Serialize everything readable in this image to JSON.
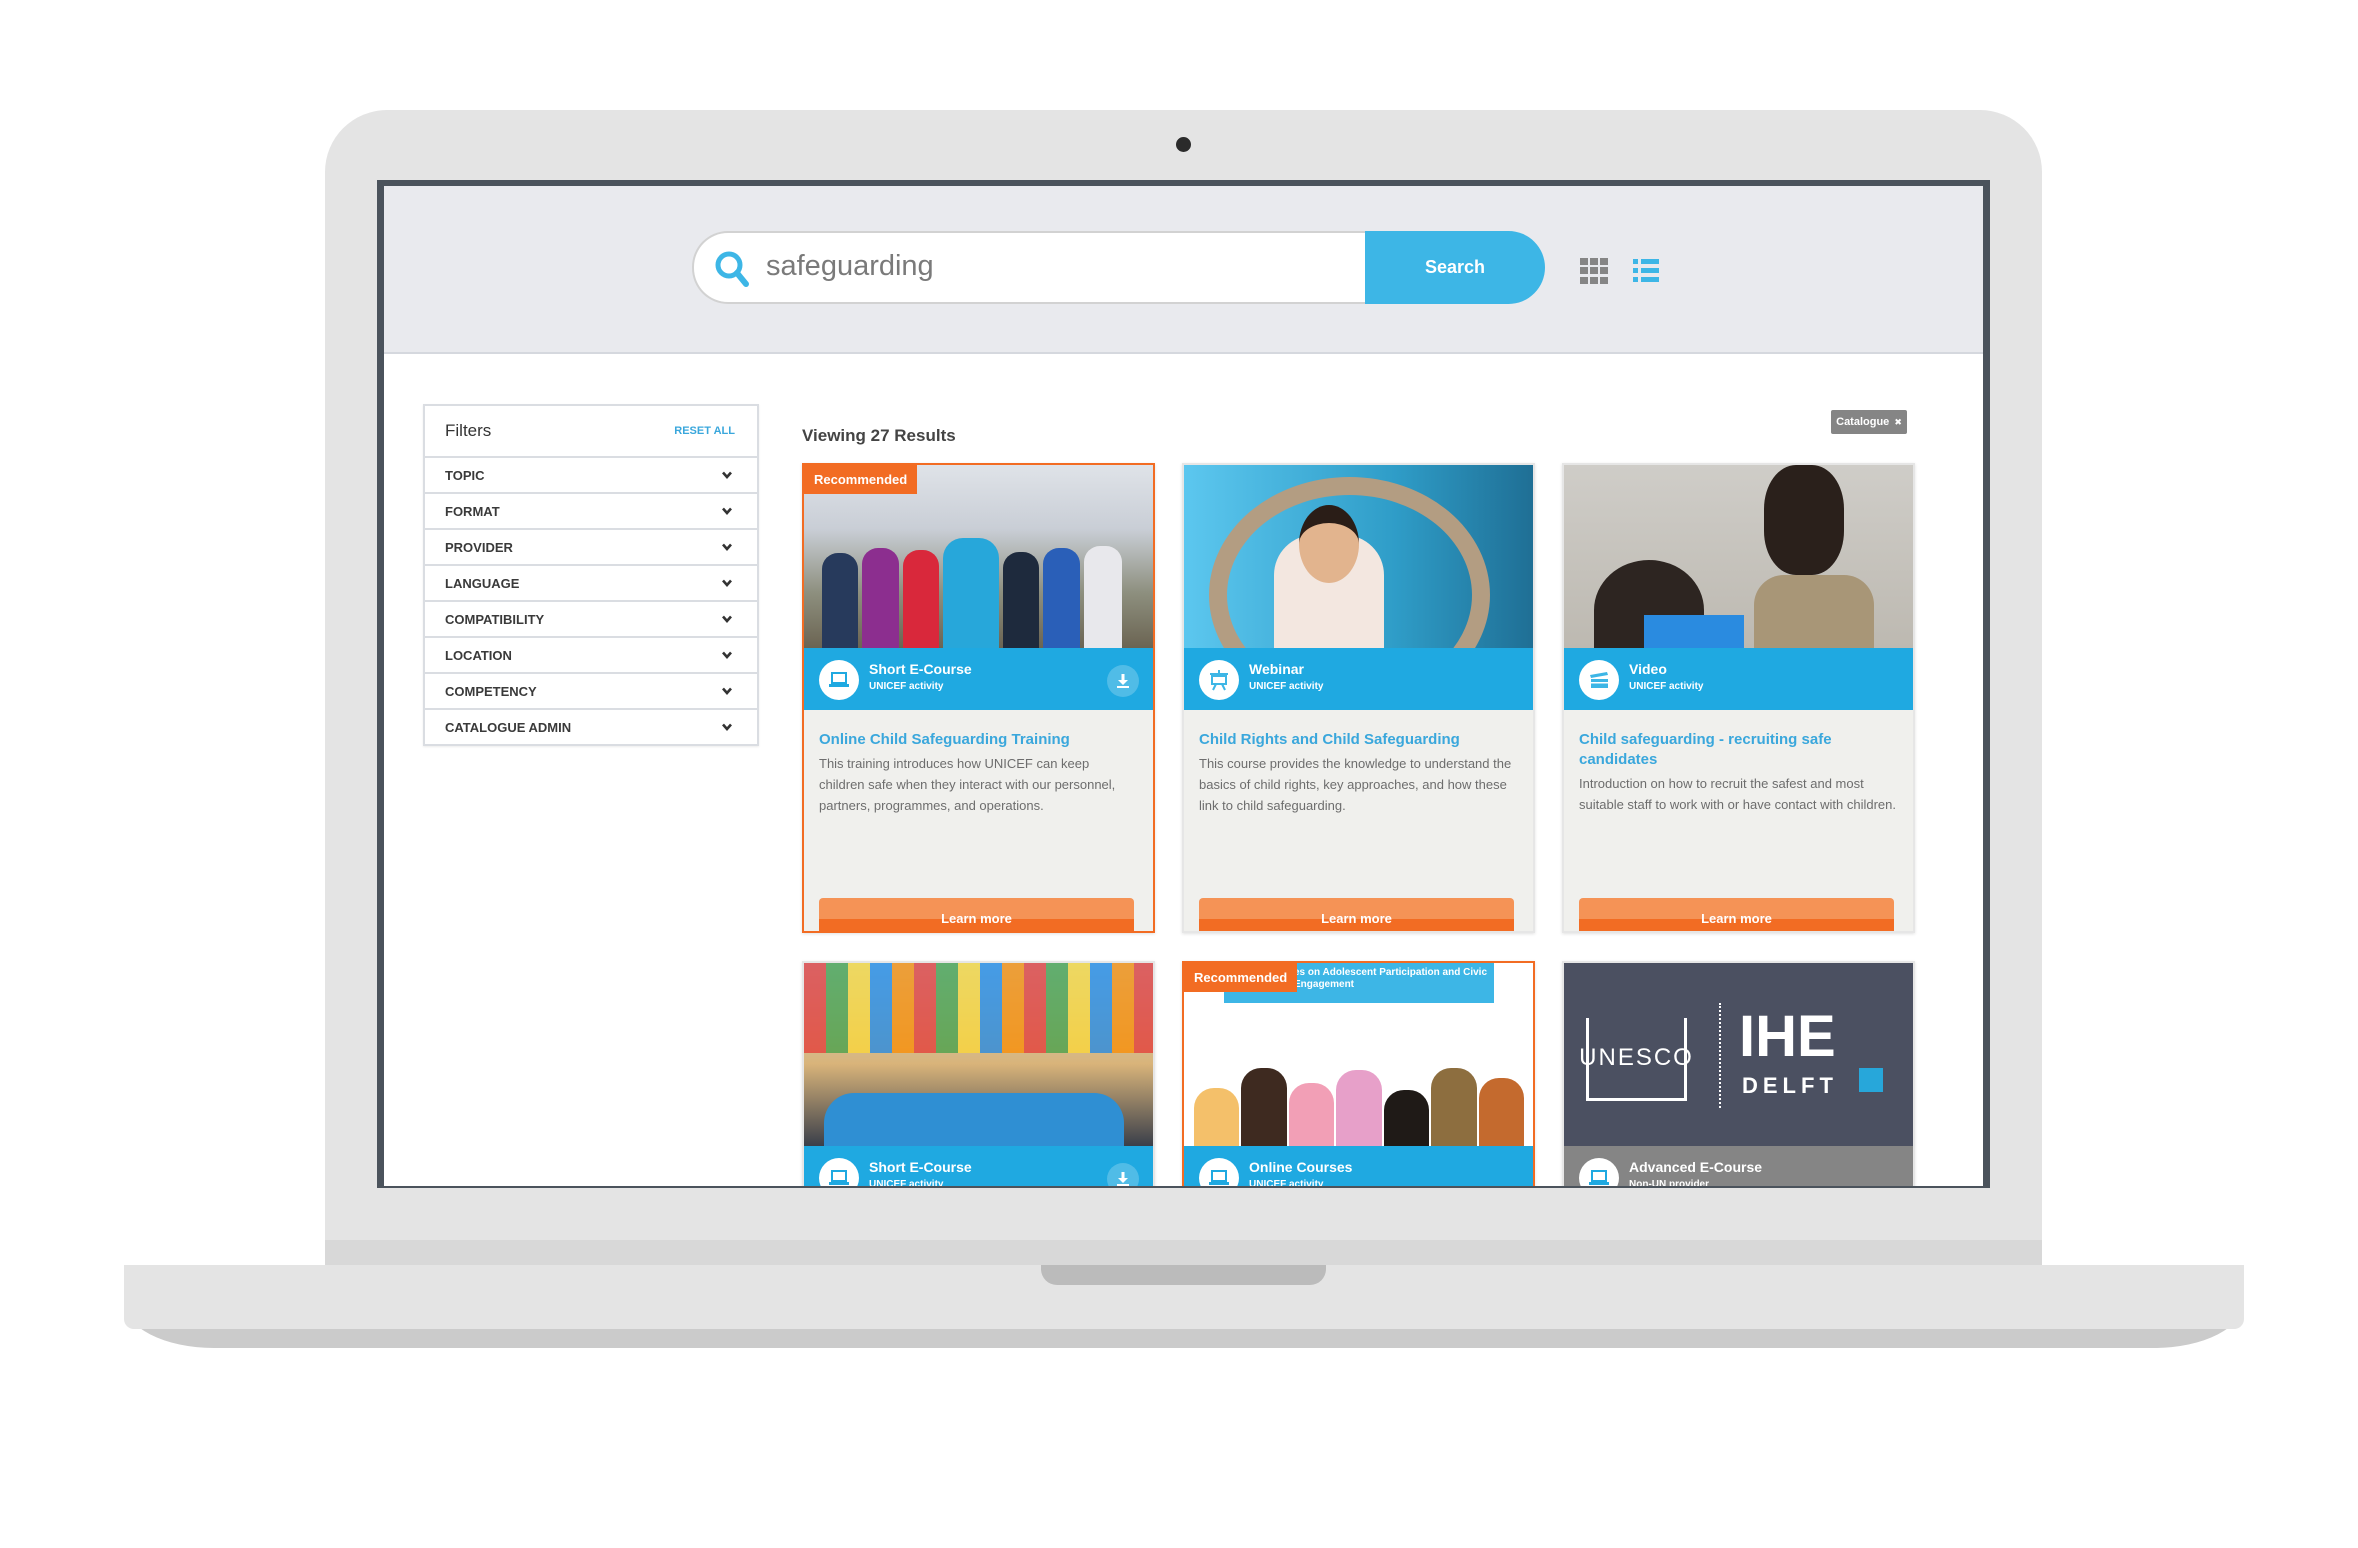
{
  "search": {
    "query": "safeguarding",
    "button_label": "Search"
  },
  "view_toggle": {
    "grid_label": "grid-view",
    "list_label": "list-view",
    "active": "list"
  },
  "filters": {
    "title": "Filters",
    "reset_label": "RESET ALL",
    "items": [
      {
        "label": "TOPIC"
      },
      {
        "label": "FORMAT"
      },
      {
        "label": "PROVIDER"
      },
      {
        "label": "LANGUAGE"
      },
      {
        "label": "COMPATIBILITY"
      },
      {
        "label": "LOCATION"
      },
      {
        "label": "COMPETENCY"
      },
      {
        "label": "CATALOGUE ADMIN"
      }
    ]
  },
  "results": {
    "title": "Viewing 27 Results",
    "active_filter_badge": "Catalogue",
    "badge_close": "✖"
  },
  "colors": {
    "accent_blue": "#3db6e6",
    "strip_blue": "#1fa9e1",
    "orange": "#f26c23",
    "grey": "#858585"
  },
  "cards": [
    {
      "recommended": true,
      "recommended_label": "Recommended",
      "image": "children-with-unicef-staff-photo",
      "format_icon": "laptop-icon",
      "format": "Short E-Course",
      "provider": "UNICEF activity",
      "downloadable": true,
      "title": "Online Child Safeguarding Training",
      "description": "This training introduces how UNICEF can keep children safe when they interact with our personnel, partners, programmes, and operations.",
      "button": "Learn more"
    },
    {
      "recommended": false,
      "image": "child-in-play-tunnel-photo",
      "format_icon": "presentation-board-icon",
      "format": "Webinar",
      "provider": "UNICEF activity",
      "downloadable": false,
      "title": "Child Rights and Child Safeguarding",
      "description": "This course provides the knowledge to understand the basics of child rights, key approaches, and how these link to child safeguarding.",
      "button": "Learn more"
    },
    {
      "recommended": false,
      "image": "man-and-boy-high-five-photo",
      "format_icon": "clapperboard-icon",
      "format": "Video",
      "provider": "UNICEF activity",
      "downloadable": false,
      "title": "Child safeguarding - recruiting safe candidates",
      "description": "Introduction on how to recruit the safest and most suitable staff to work with or have contact with children.",
      "button": "Learn more"
    },
    {
      "recommended": false,
      "image": "umbrella-street-unicef-volunteers-photo",
      "format_icon": "laptop-icon",
      "format": "Short E-Course",
      "provider": "UNICEF activity",
      "downloadable": true
    },
    {
      "recommended": true,
      "recommended_label": "Recommended",
      "image": "adolescent-participation-illustration",
      "image_caption": "es on Adolescent Participation and Civic Engagement",
      "format_icon": "laptop-icon",
      "format": "Online Courses",
      "provider": "UNICEF activity",
      "downloadable": false
    },
    {
      "recommended": false,
      "image": "unesco-ihe-delft-logo",
      "logo_left": "UNESCO",
      "logo_right_top": "IHE",
      "logo_right_bottom": "DELFT",
      "format_icon": "laptop-icon",
      "format": "Advanced E-Course",
      "provider": "Non-UN provider",
      "downloadable": false
    }
  ]
}
